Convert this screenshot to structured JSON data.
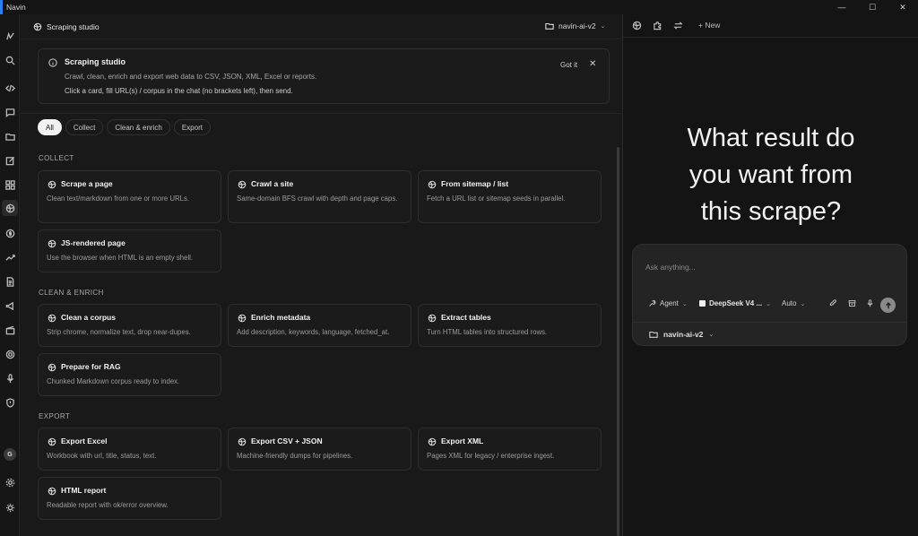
{
  "window": {
    "title": "Navin",
    "controls": [
      "—",
      "☐",
      "✕"
    ]
  },
  "header": {
    "title": "Scraping studio",
    "workspace": "navin-ai-v2"
  },
  "banner": {
    "title": "Scraping studio",
    "description": "Crawl, clean, enrich and export web data to CSV, JSON, XML, Excel or reports.",
    "hint": "Click a card, fill URL(s) / corpus in the chat (no brackets left), then send.",
    "got_it": "Got it",
    "close": "✕"
  },
  "filters": [
    {
      "label": "All",
      "active": true
    },
    {
      "label": "Collect",
      "active": false
    },
    {
      "label": "Clean & enrich",
      "active": false
    },
    {
      "label": "Export",
      "active": false
    }
  ],
  "sections": {
    "collect": {
      "label": "COLLECT",
      "cards": [
        {
          "title": "Scrape a page",
          "desc": "Clean text/markdown from one or more URLs."
        },
        {
          "title": "Crawl a site",
          "desc": "Same-domain BFS crawl with depth and page caps."
        },
        {
          "title": "From sitemap / list",
          "desc": "Fetch a URL list or sitemap seeds in parallel."
        },
        {
          "title": "JS-rendered page",
          "desc": "Use the browser when HTML is an empty shell."
        }
      ]
    },
    "clean": {
      "label": "CLEAN & ENRICH",
      "cards": [
        {
          "title": "Clean a corpus",
          "desc": "Strip chrome, normalize text, drop near-dupes."
        },
        {
          "title": "Enrich metadata",
          "desc": "Add description, keywords, language, fetched_at."
        },
        {
          "title": "Extract tables",
          "desc": "Turn HTML tables into structured rows."
        },
        {
          "title": "Prepare for RAG",
          "desc": "Chunked Markdown corpus ready to index."
        }
      ]
    },
    "export": {
      "label": "EXPORT",
      "cards": [
        {
          "title": "Export Excel",
          "desc": "Workbook with url, title, status, text."
        },
        {
          "title": "Export CSV + JSON",
          "desc": "Machine-friendly dumps for pipelines."
        },
        {
          "title": "Export XML",
          "desc": "Pages XML for legacy / enterprise ingest."
        },
        {
          "title": "HTML report",
          "desc": "Readable report with ok/error overview."
        }
      ]
    }
  },
  "right_panel": {
    "new_label": "+ New",
    "headline": "What result do\nyou want from\nthis scrape?",
    "composer": {
      "placeholder": "Ask anything...",
      "agent": "Agent",
      "model": "DeepSeek V4 ...",
      "mode": "Auto",
      "project": "navin-ai-v2"
    }
  },
  "user": {
    "avatar_initial": "G"
  }
}
